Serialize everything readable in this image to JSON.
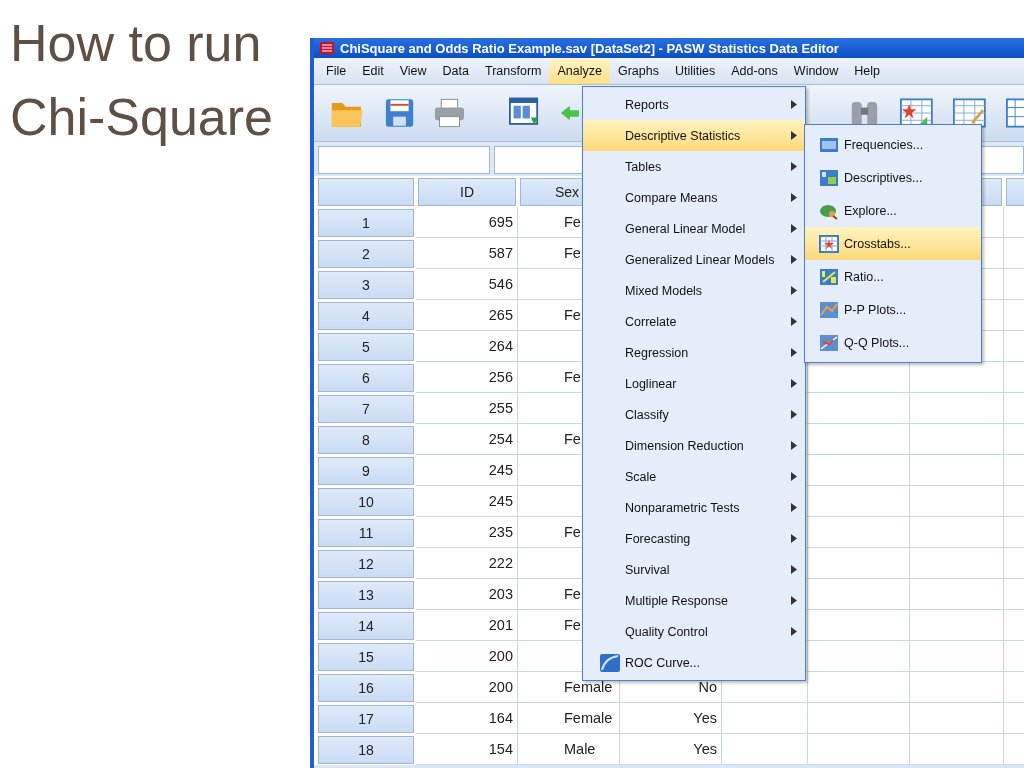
{
  "slide": {
    "heading": "How to run Chi-Square"
  },
  "window": {
    "title": "ChiSquare and Odds Ratio Example.sav [DataSet2] - PASW Statistics Data Editor"
  },
  "menu": [
    {
      "label": "File",
      "selected": false
    },
    {
      "label": "Edit",
      "selected": false
    },
    {
      "label": "View",
      "selected": false
    },
    {
      "label": "Data",
      "selected": false
    },
    {
      "label": "Transform",
      "selected": false
    },
    {
      "label": "Analyze",
      "selected": true
    },
    {
      "label": "Graphs",
      "selected": false
    },
    {
      "label": "Utilities",
      "selected": false
    },
    {
      "label": "Add-ons",
      "selected": false
    },
    {
      "label": "Window",
      "selected": false
    },
    {
      "label": "Help",
      "selected": false
    }
  ],
  "grid": {
    "columns": [
      "ID",
      "Sex"
    ],
    "rows": [
      {
        "number": "1",
        "id": "695",
        "sex": "Fe"
      },
      {
        "number": "2",
        "id": "587",
        "sex": "Fe"
      },
      {
        "number": "3",
        "id": "546"
      },
      {
        "number": "4",
        "id": "265",
        "sex": "Fe"
      },
      {
        "number": "5",
        "id": "264"
      },
      {
        "number": "6",
        "id": "256",
        "sex": "Fe"
      },
      {
        "number": "7",
        "id": "255"
      },
      {
        "number": "8",
        "id": "254",
        "sex": "Fe"
      },
      {
        "number": "9",
        "id": "245"
      },
      {
        "number": "10",
        "id": "245"
      },
      {
        "number": "11",
        "id": "235",
        "sex": "Fe"
      },
      {
        "number": "12",
        "id": "222"
      },
      {
        "number": "13",
        "id": "203",
        "sex": "Fe"
      },
      {
        "number": "14",
        "id": "201",
        "sex": "Fe"
      },
      {
        "number": "15",
        "id": "200"
      },
      {
        "number": "16",
        "id": "200",
        "sex": "Female",
        "column_3": "No"
      },
      {
        "number": "17",
        "id": "164",
        "sex": "Female",
        "column_3": "Yes"
      },
      {
        "number": "18",
        "id": "154",
        "sex": "Male",
        "column_3": "Yes"
      }
    ]
  },
  "analyze_menu": [
    {
      "label": "Reports",
      "kind": "submenu",
      "selected": false
    },
    {
      "label": "Descriptive Statistics",
      "kind": "submenu",
      "selected": true
    },
    {
      "label": "Tables",
      "kind": "submenu",
      "selected": false
    },
    {
      "label": "Compare Means",
      "kind": "submenu",
      "selected": false
    },
    {
      "label": "General Linear Model",
      "kind": "submenu",
      "selected": false
    },
    {
      "label": "Generalized Linear Models",
      "kind": "submenu",
      "selected": false
    },
    {
      "label": "Mixed Models",
      "kind": "submenu",
      "selected": false
    },
    {
      "label": "Correlate",
      "kind": "submenu",
      "selected": false
    },
    {
      "label": "Regression",
      "kind": "submenu",
      "selected": false
    },
    {
      "label": "Loglinear",
      "kind": "submenu",
      "selected": false
    },
    {
      "label": "Classify",
      "kind": "submenu",
      "selected": false
    },
    {
      "label": "Dimension Reduction",
      "kind": "submenu",
      "selected": false
    },
    {
      "label": "Scale",
      "kind": "submenu",
      "selected": false
    },
    {
      "label": "Nonparametric Tests",
      "kind": "submenu",
      "selected": false
    },
    {
      "label": "Forecasting",
      "kind": "submenu",
      "selected": false
    },
    {
      "label": "Survival",
      "kind": "submenu",
      "selected": false
    },
    {
      "label": "Multiple Response",
      "kind": "submenu",
      "selected": false
    },
    {
      "label": "Quality Control",
      "kind": "submenu",
      "selected": false
    },
    {
      "label": "ROC Curve...",
      "kind": "command",
      "selected": false
    }
  ],
  "descriptive_submenu": [
    {
      "label": "Frequencies...",
      "selected": false
    },
    {
      "label": "Descriptives...",
      "selected": false
    },
    {
      "label": "Explore...",
      "selected": false
    },
    {
      "label": "Crosstabs...",
      "selected": true
    },
    {
      "label": "Ratio...",
      "selected": false
    },
    {
      "label": "P-P Plots...",
      "selected": false
    },
    {
      "label": "Q-Q Plots...",
      "selected": false
    }
  ]
}
